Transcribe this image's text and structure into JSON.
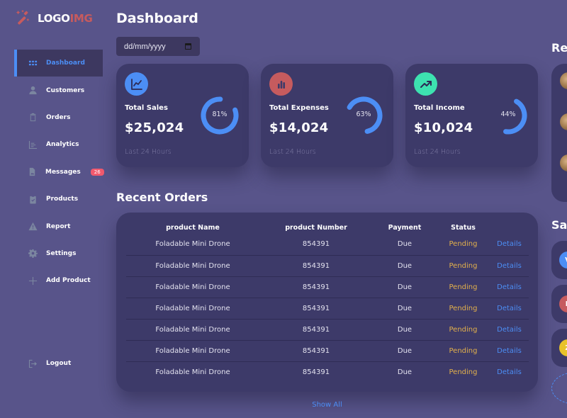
{
  "logo": {
    "text_main": "LOGO",
    "text_accent": "IMG",
    "icon": "magic-wand-icon"
  },
  "sidebar": {
    "items": [
      {
        "label": "Dashboard",
        "icon": "grid-icon",
        "active": true
      },
      {
        "label": "Customers",
        "icon": "person-icon"
      },
      {
        "label": "Orders",
        "icon": "clipboard-icon"
      },
      {
        "label": "Analytics",
        "icon": "bar-chart-icon"
      },
      {
        "label": "Messages",
        "icon": "document-icon",
        "badge": "26"
      },
      {
        "label": "Products",
        "icon": "clipboard-check-icon"
      },
      {
        "label": "Report",
        "icon": "warning-icon"
      },
      {
        "label": "Settings",
        "icon": "gear-icon"
      },
      {
        "label": "Add Product",
        "icon": "plus-icon"
      }
    ],
    "logout": {
      "label": "Logout",
      "icon": "logout-icon"
    }
  },
  "header": {
    "title": "Dashboard"
  },
  "date_filter": {
    "placeholder": "dd/mm/yyyy",
    "icon": "calendar-icon"
  },
  "cards": [
    {
      "label": "Total Sales",
      "value": "$25,024",
      "percent": 81,
      "percent_label": "81%",
      "sub": "Last 24 Hours",
      "icon": "line-chart-icon",
      "icon_color": "#4c8ef5"
    },
    {
      "label": "Total Expenses",
      "value": "$14,024",
      "percent": 63,
      "percent_label": "63%",
      "sub": "Last 24 Hours",
      "icon": "bar-chart-icon",
      "icon_color": "#c65b5e"
    },
    {
      "label": "Total Income",
      "value": "$10,024",
      "percent": 44,
      "percent_label": "44%",
      "sub": "Last 24 Hours",
      "icon": "trending-up-icon",
      "icon_color": "#3de2b0"
    }
  ],
  "colors": {
    "accent": "#4c8ef5",
    "pending": "#e2b04c",
    "badge": "#f25a6e",
    "card_bg": "#3d3a69",
    "page_bg": "#58548a"
  },
  "recent_orders": {
    "title": "Recent Orders",
    "columns": [
      "product Name",
      "product Number",
      "Payment",
      "Status",
      ""
    ],
    "rows": [
      {
        "name": "Foladable Mini Drone",
        "number": "854391",
        "payment": "Due",
        "status": "Pending",
        "action": "Details"
      },
      {
        "name": "Foladable Mini Drone",
        "number": "854391",
        "payment": "Due",
        "status": "Pending",
        "action": "Details"
      },
      {
        "name": "Foladable Mini Drone",
        "number": "854391",
        "payment": "Due",
        "status": "Pending",
        "action": "Details"
      },
      {
        "name": "Foladable Mini Drone",
        "number": "854391",
        "payment": "Due",
        "status": "Pending",
        "action": "Details"
      },
      {
        "name": "Foladable Mini Drone",
        "number": "854391",
        "payment": "Due",
        "status": "Pending",
        "action": "Details"
      },
      {
        "name": "Foladable Mini Drone",
        "number": "854391",
        "payment": "Due",
        "status": "Pending",
        "action": "Details"
      },
      {
        "name": "Foladable Mini Drone",
        "number": "854391",
        "payment": "Due",
        "status": "Pending",
        "action": "Details"
      }
    ],
    "show_all": "Show All"
  },
  "right_panel": {
    "updates_title": "Re",
    "sales_title": "Sa",
    "sales_items": [
      {
        "initial": "V",
        "color": "#4c8ef5"
      },
      {
        "initial": "E",
        "color": "#c65b5e"
      },
      {
        "initial": "Z",
        "color": "#e8c22a"
      }
    ]
  }
}
